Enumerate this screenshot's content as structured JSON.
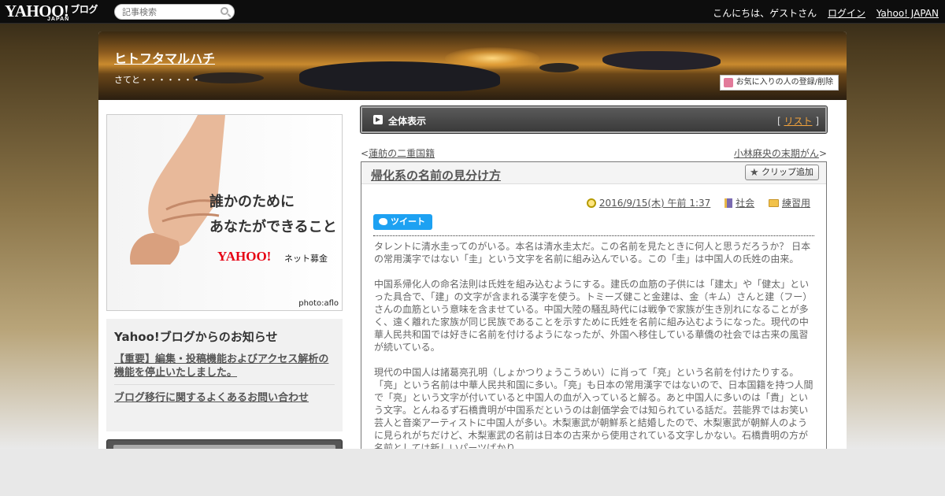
{
  "topbar": {
    "logo": "YAHOO!",
    "logo_sub": "JAPAN",
    "logo_blog": "ブログ",
    "search_placeholder": "記事検索",
    "greeting": "こんにちは、ゲストさん",
    "login": "ログイン",
    "yahoo_japan": "Yahoo! JAPAN"
  },
  "header": {
    "blog_title": "ヒトフタマルハチ",
    "blog_subtitle": "さてと・・・・・・・",
    "favorite_button": "お気に入りの人の登録/削除"
  },
  "ad": {
    "line1": "誰かのために",
    "line2": "あなたができること",
    "logo": "YAHOO!",
    "logo_sub": "JAPAN",
    "service": "ネット募金",
    "credit": "photo:aflo"
  },
  "notice": {
    "heading": "Yahoo!ブログからのお知らせ",
    "links": [
      "【重要】編集・投稿機能およびアクセス解析の機能を停止いたしました。",
      "ブログ移行に関するよくあるお問い合わせ"
    ]
  },
  "tabbar": {
    "label": "全体表示",
    "list_link": "リスト"
  },
  "pager": {
    "prev": "蓮舫の二重国籍",
    "next": "小林麻央の末期がん"
  },
  "article": {
    "title": "帰化系の名前の見分け方",
    "clip_button": "クリップ追加",
    "date": "2016/9/15(木) 午前 1:37",
    "category": "社会",
    "folder": "練習用",
    "tweet": "ツイート",
    "paragraphs": [
      "タレントに清水圭ってのがいる。本名は清水圭太だ。この名前を見たときに何人と思うだろうか？ 日本の常用漢字ではない「圭」という文字を名前に組み込んでいる。この「圭」は中国人の氏姓の由来。",
      "中国系帰化人の命名法則は氏姓を組み込むようにする。建氏の血筋の子供には「建太」や「健太」といった具合で、「建」の文字が含まれる漢字を使う。トミーズ健こと金建は、金（キム）さんと建（フー）さんの血筋という意味を含ませている。中国大陸の騒乱時代には戦争で家族が生き別れになることが多く、遠く離れた家族が同じ民族であることを示すために氏姓を名前に組み込むようになった。現代の中華人民共和国では好きに名前を付けるようになったが、外国へ移住している華僑の社会では古来の風習が続いている。",
      "現代の中国人は諸葛亮孔明（しょかつりょうこうめい）に肖って「亮」という名前を付けたりする。「亮」という名前は中華人民共和国に多い。「亮」も日本の常用漢字ではないので、日本国籍を持つ人間で「亮」という文字が付いていると中国人の血が入っていると解る。あと中国人に多いのは「貴」という文字。とんねるず石橋貴明が中国系だというのは創価学会では知られている話だ。芸能界ではお笑い芸人と音楽アーティストに中国人が多い。木梨憲武が朝鮮系と結婚したので、木梨憲武が朝鮮人のように見られがちだけど、木梨憲武の名前は日本の古来から使用されている文字しかない。石橋貴明の方が名前としては新しいパーツばかり。"
    ]
  }
}
